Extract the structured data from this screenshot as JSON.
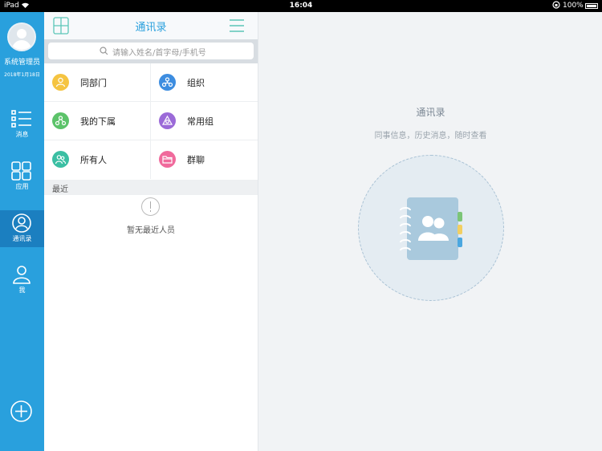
{
  "status_bar": {
    "device": "iPad",
    "time": "16:04",
    "battery": "100%"
  },
  "sidebar": {
    "user_name": "系统管理员",
    "user_date": "2018年1月18日",
    "items": [
      {
        "label": "消息",
        "icon": "message-list-icon"
      },
      {
        "label": "应用",
        "icon": "apps-grid-icon"
      },
      {
        "label": "通讯录",
        "icon": "contacts-icon",
        "active": true
      },
      {
        "label": "我",
        "icon": "person-icon"
      }
    ]
  },
  "contacts_panel": {
    "title": "通讯录",
    "search_placeholder": "请输入姓名/首字母/手机号",
    "cells": [
      {
        "label": "同部门",
        "icon": "department-icon",
        "color": "#f5c441"
      },
      {
        "label": "组织",
        "icon": "organization-icon",
        "color": "#3d8de0"
      },
      {
        "label": "我的下属",
        "icon": "subordinates-icon",
        "color": "#5cc36a"
      },
      {
        "label": "常用组",
        "icon": "common-group-icon",
        "color": "#9b6ad8"
      },
      {
        "label": "所有人",
        "icon": "all-people-icon",
        "color": "#3bbfa3"
      },
      {
        "label": "群聊",
        "icon": "group-chat-icon",
        "color": "#f06a9c"
      }
    ],
    "recent_label": "最近",
    "empty_text": "暂无最近人员"
  },
  "detail_panel": {
    "title": "通讯录",
    "subtitle": "同事信息，历史消息，随时查看"
  },
  "colors": {
    "accent": "#29a0dd",
    "sidebar_active": "#1b7fc0"
  }
}
